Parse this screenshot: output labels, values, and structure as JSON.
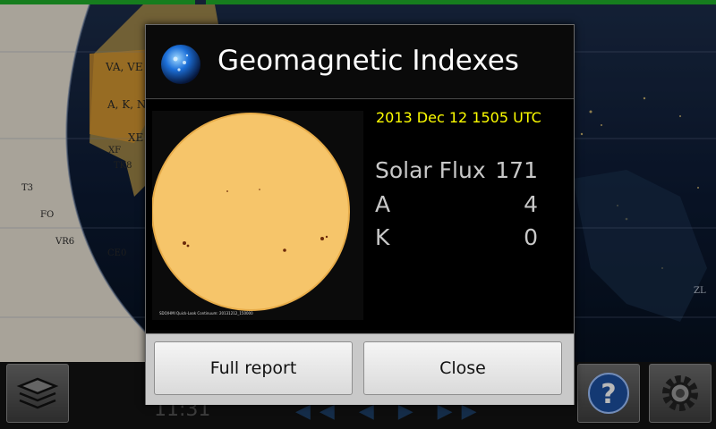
{
  "map": {
    "labels": [
      "VA, VE",
      "A, K, N",
      "XE",
      "XF",
      "TK8",
      "T3",
      "FO",
      "VR6",
      "CE0",
      "ZL"
    ]
  },
  "bottom_bar": {
    "clock": "11:31",
    "icons": [
      "layers-icon",
      "help-icon",
      "settings-icon"
    ]
  },
  "dialog": {
    "title": "Geomagnetic Indexes",
    "icon": "sun-globe-icon",
    "timestamp": "2013 Dec 12 1505 UTC",
    "image_caption": "SDO/HMI Quick-Look Continuum: 20131212_150000",
    "rows": [
      {
        "label": "Solar Flux",
        "value": "171"
      },
      {
        "label": "A",
        "value": "4"
      },
      {
        "label": "K",
        "value": "0"
      }
    ],
    "buttons": {
      "full_report": "Full report",
      "close": "Close"
    },
    "colors": {
      "timestamp": "#ffff00",
      "sun": "#f6c56a"
    }
  }
}
